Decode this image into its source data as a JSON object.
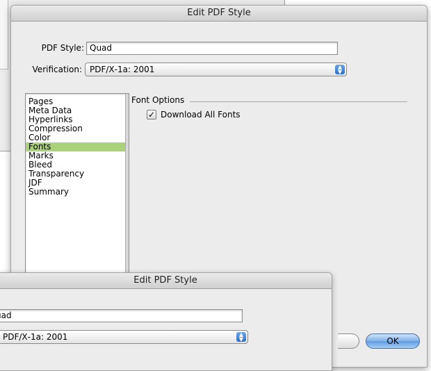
{
  "main_dialog": {
    "title": "Edit PDF Style",
    "pdf_style_label": "PDF Style:",
    "pdf_style_value": "Quad",
    "verification_label": "Verification:",
    "verification_value": "PDF/X‑1a: 2001",
    "sections": [
      "Pages",
      "Meta Data",
      "Hyperlinks",
      "Compression",
      "Color",
      "Fonts",
      "Marks",
      "Bleed",
      "Transparency",
      "JDF",
      "Summary"
    ],
    "selected_section": "Fonts",
    "font_options_title": "Font Options",
    "download_all_fonts_label": "Download All Fonts",
    "download_all_fonts_checked": true,
    "ok_label": "OK"
  },
  "ghost_dialog": {
    "title": "Edit PDF Style",
    "pdf_style_value": "uad",
    "verification_value": "PDF/X‑1a: 2001"
  },
  "colors": {
    "selection": "#a9d27a",
    "accent_blue": "#5e9be3"
  }
}
